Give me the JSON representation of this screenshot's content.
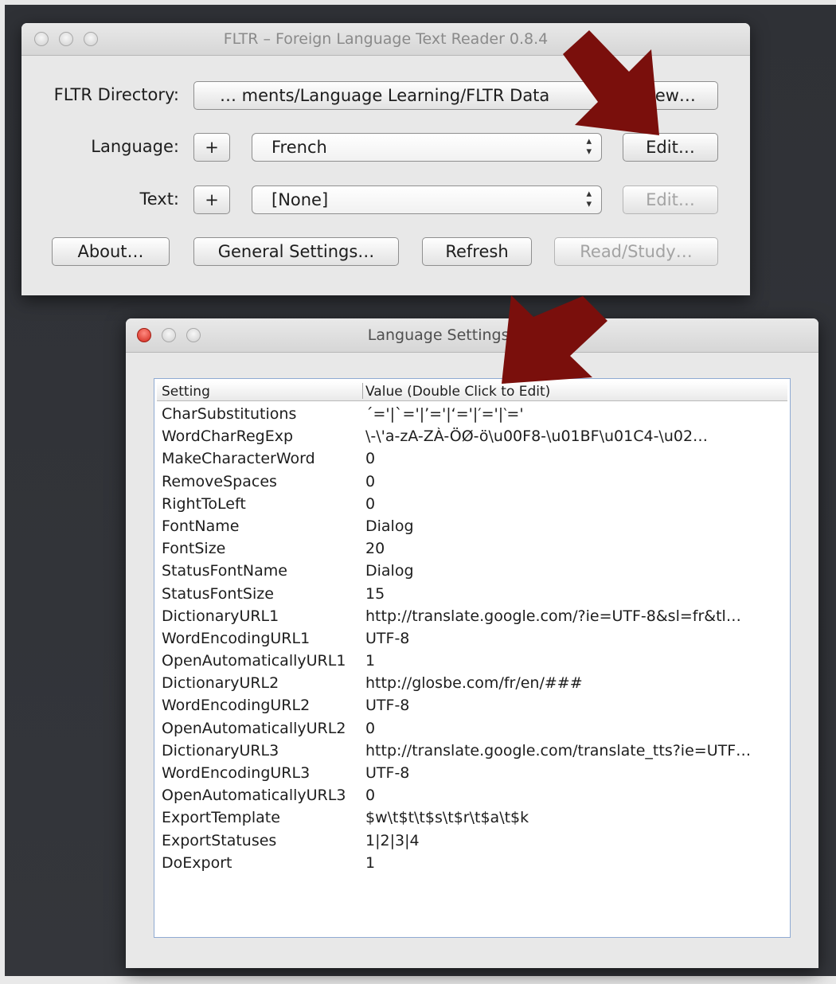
{
  "main_window": {
    "title": "FLTR – Foreign Language Text Reader 0.8.4",
    "directory_label": "FLTR Directory:",
    "directory_value": "… ments/Language Learning/FLTR Data",
    "view_button": "View…",
    "language_label": "Language:",
    "language_add": "+",
    "language_value": "French",
    "language_edit": "Edit…",
    "text_label": "Text:",
    "text_add": "+",
    "text_value": "[None]",
    "text_edit": "Edit…",
    "about_button": "About…",
    "general_settings_button": "General Settings…",
    "refresh_button": "Refresh",
    "read_study_button": "Read/Study…"
  },
  "settings_window": {
    "title": "Language Settings – French",
    "col_setting": "Setting",
    "col_value": "Value (Double Click to Edit)",
    "rows": [
      {
        "setting": "CharSubstitutions",
        "value": "´='|`='|’='|‘='|′='|‵='"
      },
      {
        "setting": "WordCharRegExp",
        "value": "\\-\\'a-zA-ZÀ-ÖØ-ö\\u00F8-\\u01BF\\u01C4-\\u02…"
      },
      {
        "setting": "MakeCharacterWord",
        "value": "0"
      },
      {
        "setting": "RemoveSpaces",
        "value": "0"
      },
      {
        "setting": "RightToLeft",
        "value": "0"
      },
      {
        "setting": "FontName",
        "value": "Dialog"
      },
      {
        "setting": "FontSize",
        "value": "20"
      },
      {
        "setting": "StatusFontName",
        "value": "Dialog"
      },
      {
        "setting": "StatusFontSize",
        "value": "15"
      },
      {
        "setting": "DictionaryURL1",
        "value": "http://translate.google.com/?ie=UTF-8&sl=fr&tl…"
      },
      {
        "setting": "WordEncodingURL1",
        "value": "UTF-8"
      },
      {
        "setting": "OpenAutomaticallyURL1",
        "value": "1"
      },
      {
        "setting": "DictionaryURL2",
        "value": "http://glosbe.com/fr/en/###"
      },
      {
        "setting": "WordEncodingURL2",
        "value": "UTF-8"
      },
      {
        "setting": "OpenAutomaticallyURL2",
        "value": "0"
      },
      {
        "setting": "DictionaryURL3",
        "value": "http://translate.google.com/translate_tts?ie=UTF…"
      },
      {
        "setting": "WordEncodingURL3",
        "value": "UTF-8"
      },
      {
        "setting": "OpenAutomaticallyURL3",
        "value": "0"
      },
      {
        "setting": "ExportTemplate",
        "value": "$w\\t$t\\t$s\\t$r\\t$a\\t$k"
      },
      {
        "setting": "ExportStatuses",
        "value": "1|2|3|4"
      },
      {
        "setting": "DoExport",
        "value": "1"
      }
    ]
  },
  "colors": {
    "arrow": "#7a0f0c",
    "close_button": "#d0281c",
    "desktop": "#32343a"
  }
}
